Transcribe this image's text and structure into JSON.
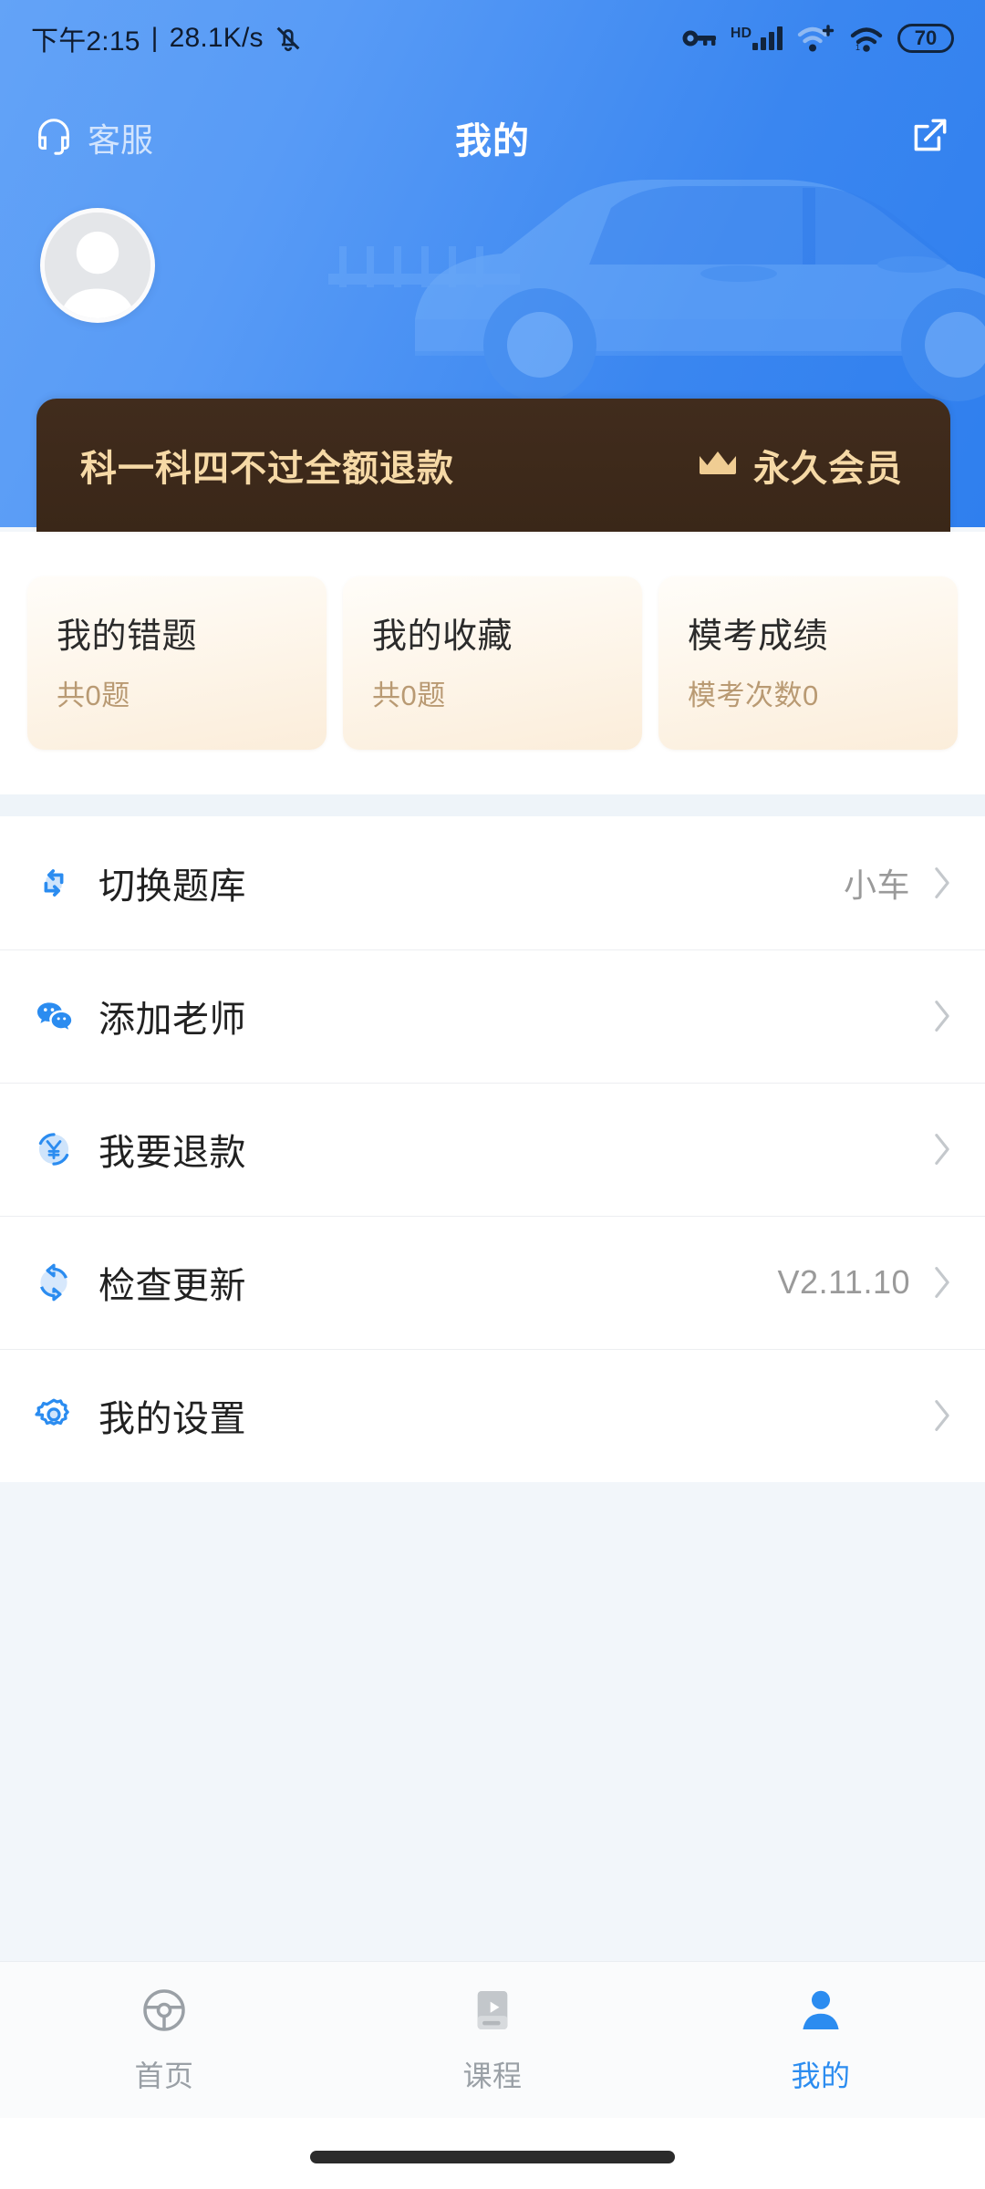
{
  "status_bar": {
    "time": "下午2:15",
    "separator": "|",
    "network_speed": "28.1K/s",
    "mute_icon": "bell-muted-icon",
    "key_icon": "vpn-key-icon",
    "hd_label": "HD",
    "signal_icon": "cellular-signal-icon",
    "wifi_plus_icon": "wifi-plus-icon",
    "wifi_icon": "wifi-icon",
    "battery_level": "70"
  },
  "header": {
    "support_icon": "headset-icon",
    "support_label": "客服",
    "title": "我的",
    "share_icon": "share-icon",
    "avatar_icon": "default-avatar-icon",
    "background_art": "car-illustration"
  },
  "vip_banner": {
    "promise_text": "科一科四不过全额退款",
    "crown_icon": "crown-icon",
    "member_label": "永久会员",
    "background_color": "#3d2818",
    "text_color": "#f6d9a6"
  },
  "stat_cards": [
    {
      "title": "我的错题",
      "subtitle": "共0题"
    },
    {
      "title": "我的收藏",
      "subtitle": "共0题"
    },
    {
      "title": "模考成绩",
      "subtitle": "模考次数0"
    }
  ],
  "menu": [
    {
      "icon": "swap-arrows-icon",
      "label": "切换题库",
      "value": "小车",
      "chevron": "chevron-right-icon"
    },
    {
      "icon": "wechat-icon",
      "label": "添加老师",
      "value": "",
      "chevron": "chevron-right-icon"
    },
    {
      "icon": "yen-refund-icon",
      "label": "我要退款",
      "value": "",
      "chevron": "chevron-right-icon"
    },
    {
      "icon": "refresh-circle-icon",
      "label": "检查更新",
      "value": "V2.11.10",
      "chevron": "chevron-right-icon"
    },
    {
      "icon": "gear-icon",
      "label": "我的设置",
      "value": "",
      "chevron": "chevron-right-icon"
    }
  ],
  "tabbar": {
    "items": [
      {
        "icon": "steering-wheel-icon",
        "label": "首页",
        "active": false
      },
      {
        "icon": "course-video-icon",
        "label": "课程",
        "active": false
      },
      {
        "icon": "person-icon",
        "label": "我的",
        "active": true
      }
    ],
    "active_color": "#2b8cf0",
    "inactive_color": "#9aa0a6"
  }
}
